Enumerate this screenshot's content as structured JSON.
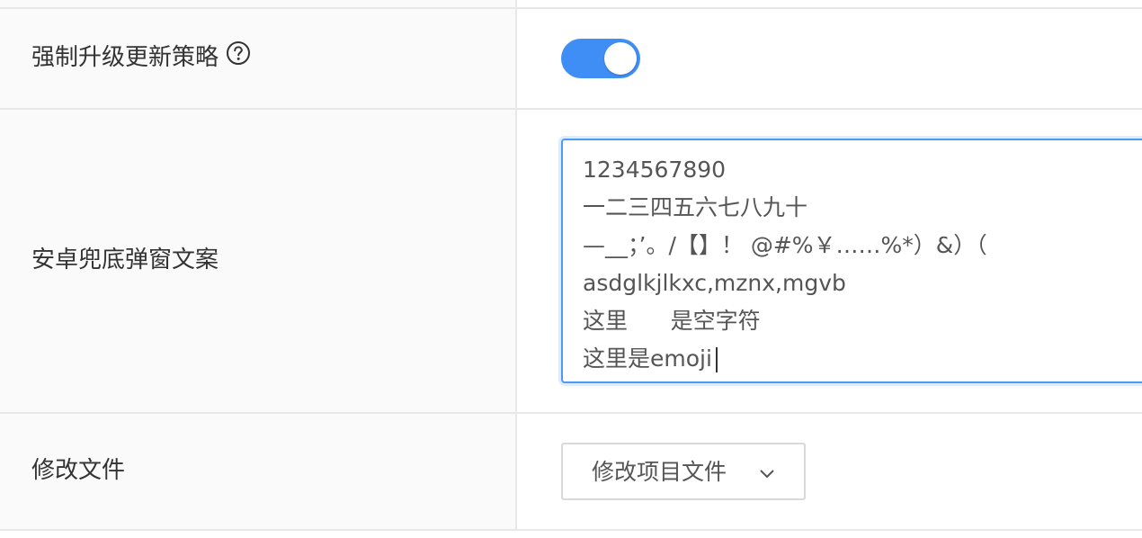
{
  "form": {
    "force_update": {
      "label": "强制升级更新策略",
      "help_icon": "question-circle-icon",
      "switch_on": true,
      "switch_color": "#3f8ef5"
    },
    "android_fallback_popup": {
      "label": "安卓兜底弹窗文案",
      "lines": [
        "1234567890",
        "一二三四五六七八九十",
        "—__；’。/【】！ @#%￥……%*）&）（",
        "asdglkjlkxc,mznx,mgvb",
        "这里      是空字符",
        "这里是emoji"
      ],
      "border_color": "#4a9cf2"
    },
    "modify_file": {
      "label": "修改文件",
      "button_label": "修改项目文件",
      "chevron_icon": "chevron-down-icon"
    }
  }
}
